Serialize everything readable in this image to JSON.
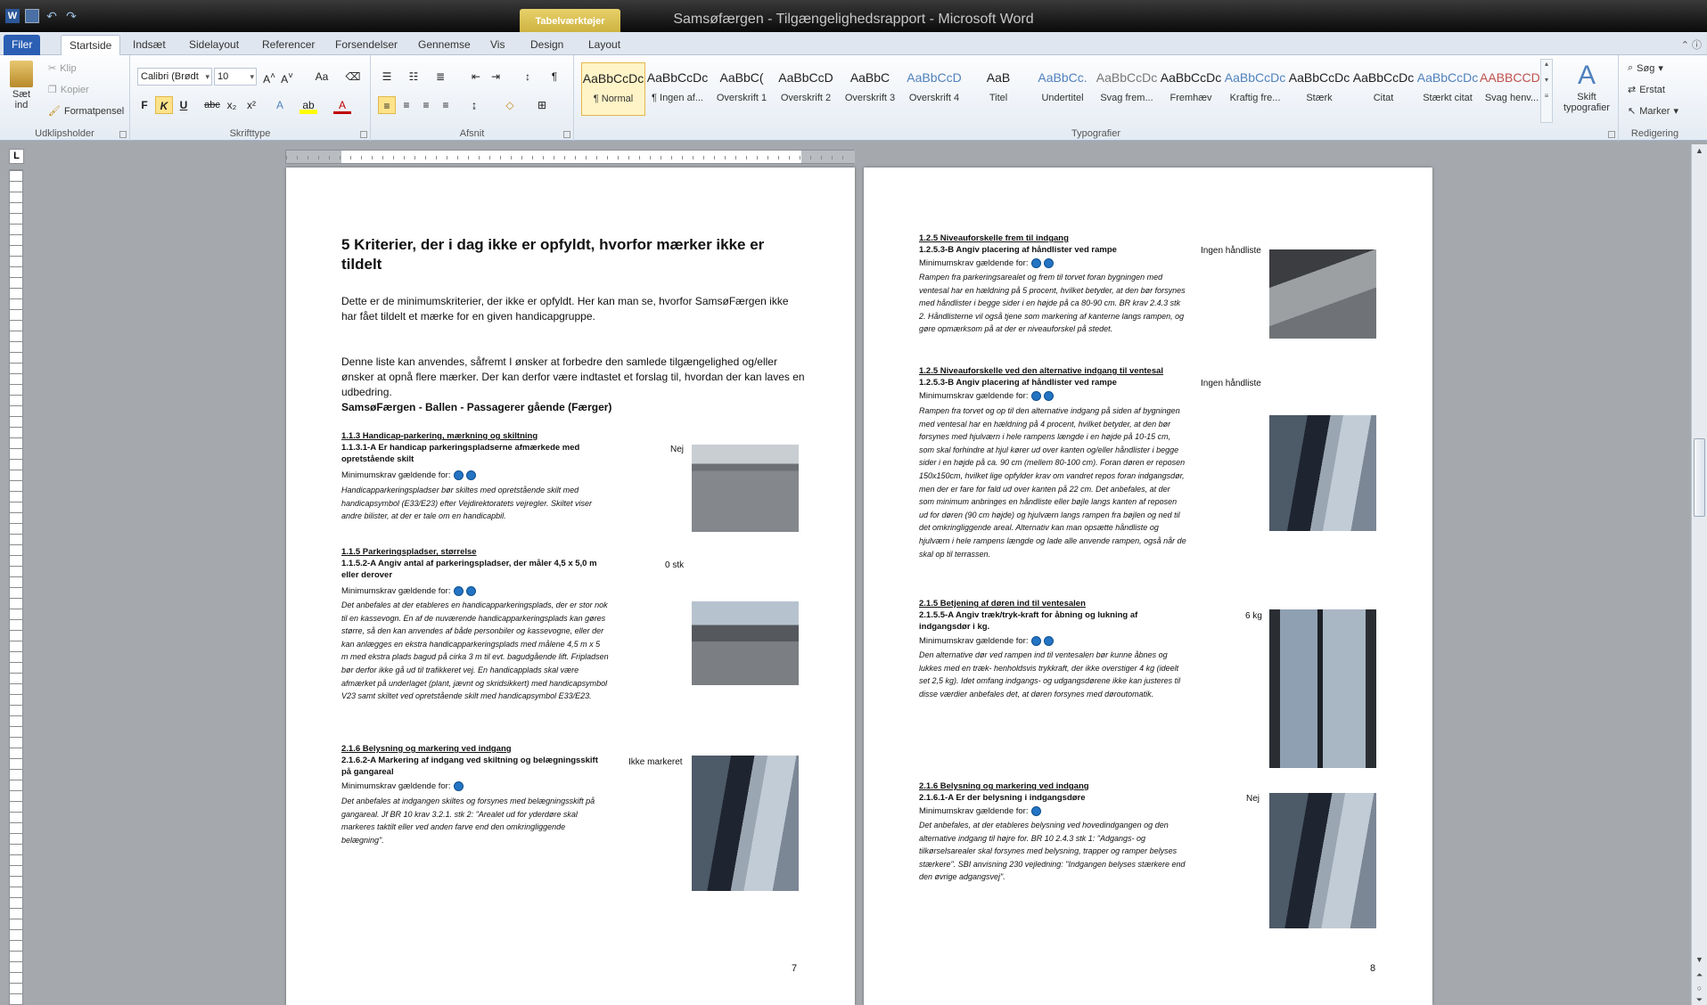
{
  "window": {
    "title": "Samsøfærgen - Tilgængelighedsrapport - Microsoft Word",
    "context_tab": "Tabelværktøjer"
  },
  "tabs": [
    "Filer",
    "Startside",
    "Indsæt",
    "Sidelayout",
    "Referencer",
    "Forsendelser",
    "Gennemse",
    "Vis",
    "Design",
    "Layout"
  ],
  "ribbon": {
    "clipboard": {
      "paste": "Sæt ind",
      "cut": "Klip",
      "copy": "Kopier",
      "format_painter": "Formatpensel",
      "label": "Udklipsholder"
    },
    "font": {
      "name": "Calibri (Brødt",
      "size": "10",
      "label": "Skrifttype"
    },
    "paragraph": {
      "label": "Afsnit"
    },
    "styles": {
      "label": "Typografier",
      "items": [
        {
          "preview": "AaBbCcDc",
          "name": "¶ Normal",
          "color": "#222"
        },
        {
          "preview": "AaBbCcDc",
          "name": "¶ Ingen af...",
          "color": "#222"
        },
        {
          "preview": "AaBbC(",
          "name": "Overskrift 1",
          "color": "#222"
        },
        {
          "preview": "AaBbCcD",
          "name": "Overskrift 2",
          "color": "#222"
        },
        {
          "preview": "AaBbC",
          "name": "Overskrift 3",
          "color": "#222"
        },
        {
          "preview": "AaBbCcD",
          "name": "Overskrift 4",
          "color": "#4f81bd"
        },
        {
          "preview": "AaB",
          "name": "Titel",
          "color": "#222"
        },
        {
          "preview": "AaBbCc.",
          "name": "Undertitel",
          "color": "#4f81bd"
        },
        {
          "preview": "AaBbCcDc",
          "name": "Svag frem...",
          "color": "#777"
        },
        {
          "preview": "AaBbCcDc",
          "name": "Fremhæv",
          "color": "#222"
        },
        {
          "preview": "AaBbCcDc",
          "name": "Kraftig fre...",
          "color": "#4f81bd"
        },
        {
          "preview": "AaBbCcDc",
          "name": "Stærk",
          "color": "#222"
        },
        {
          "preview": "AaBbCcDc",
          "name": "Citat",
          "color": "#222"
        },
        {
          "preview": "AaBbCcDc",
          "name": "Stærkt citat",
          "color": "#4f81bd"
        },
        {
          "preview": "AABBCCDC",
          "name": "Svag henv...",
          "color": "#c0504d"
        }
      ],
      "change_styles": "Skift typografier"
    },
    "editing": {
      "find": "Søg",
      "replace": "Erstat",
      "select": "Marker",
      "label": "Redigering"
    }
  },
  "page7": {
    "heading": "5 Kriterier, der i dag ikke er opfyldt, hvorfor mærker ikke er tildelt",
    "intro1": "Dette er de minimumskriterier, der ikke er opfyldt. Her kan man se, hvorfor SamsøFærgen ikke har fået tildelt et mærke for en given handicapgruppe.",
    "intro2": "Denne liste kan anvendes, såfremt I ønsker at forbedre den samlede tilgængelighed og/eller ønsker at opnå flere mærker. Der kan derfor være indtastet et forslag til, hvordan der kan laves en udbedring.",
    "subheading": "SamsøFærgen - Ballen - Passagerer gående (Færger)",
    "req_label": "Minimumskrav gældende for:",
    "items": [
      {
        "section": "1.1.3 Handicap-parkering, mærkning og skiltning",
        "title": "1.1.3.1-A Er handicap parkeringspladserne afmærkede med opretstående skilt",
        "answer": "Nej",
        "text": "Handicapparkeringspladser bør skiltes med opretstående skilt med handicapsymbol (E33/E23) efter Vejdirektoratets vejregler. Skiltet viser andre bilister, at der er tale om en handicapbil."
      },
      {
        "section": "1.1.5 Parkeringspladser, størrelse",
        "title": "1.1.5.2-A Angiv antal af parkeringspladser, der måler 4,5 x 5,0 m eller derover",
        "answer": "0 stk",
        "text": "Det anbefales at der etableres en handicapparkeringsplads, der er stor nok til en kassevogn. En af de nuværende handicapparkeringsplads kan gøres større, så den kan anvendes af både personbiler og kassevogne, eller der kan anlægges en ekstra handicapparkeringsplads med målene 4,5 m x 5 m med ekstra plads bagud på cirka 3 m til evt. bagudgående lift. Fripladsen bør derfor ikke gå ud til trafikkeret vej. En handicapplads skal være afmærket på underlaget (plant, jævnt og skridsikkert) med handicapsymbol V23 samt skiltet ved opretstående skilt med handicapsymbol E33/E23."
      },
      {
        "section": "2.1.6 Belysning og markering ved indgang",
        "title": "2.1.6.2-A Markering af indgang ved skiltning og belægningsskift på gangareal",
        "answer": "Ikke markeret",
        "text": "Det anbefales at indgangen skiltes og forsynes med belægningsskift på gangareal. Jf BR 10 krav 3.2.1. stk 2: \"Arealet ud for yderdøre skal markeres taktilt eller ved anden farve end den omkringliggende belægning\"."
      }
    ],
    "page_number": "7"
  },
  "page8": {
    "req_label": "Minimumskrav gældende for:",
    "items": [
      {
        "section": "1.2.5 Niveauforskelle frem til indgang",
        "title": "1.2.5.3-B Angiv placering af håndlister ved rampe",
        "answer": "Ingen håndliste",
        "text": "Rampen fra parkeringsarealet og frem til torvet foran bygningen med ventesal har en hældning på 5 procent, hvilket betyder, at den bør forsynes med håndlister i begge sider i en højde på ca 80-90 cm. BR krav 2.4.3 stk 2. Håndlisterne vil også tjene som markering af kanterne langs rampen, og gøre opmærksom på at der er niveauforskel på stedet."
      },
      {
        "section": "1.2.5 Niveauforskelle ved den alternative indgang til ventesal",
        "title": "1.2.5.3-B Angiv placering af håndlister ved rampe",
        "answer": "Ingen håndliste",
        "text": "Rampen fra torvet og op til den alternative indgang på siden af bygningen med ventesal har en hældning på 4 procent, hvilket betyder, at den bør forsynes med hjulværn i hele rampens længde i en højde på 10-15 cm, som skal forhindre at hjul kører ud over kanten og/eller håndlister i begge sider i en højde på ca. 90 cm (mellem 80-100 cm). Foran døren er reposen 150x150cm, hvilket lige opfylder krav om vandret repos foran indgangsdør, men der er fare for fald ud over kanten på 22 cm. Det anbefales, at der som minimum anbringes en håndliste eller bøjle langs kanten af reposen ud for døren (90 cm højde) og hjulværn langs rampen fra bøjlen og ned til det omkringliggende areal. Alternativ kan man opsætte håndliste og hjulværn i hele rampens længde og lade alle anvende rampen, også når de skal op til terrassen."
      },
      {
        "section": "2.1.5 Betjening af døren ind til ventesalen",
        "title": "2.1.5.5-A Angiv træk/tryk-kraft for åbning og lukning af indgangsdør i kg.",
        "answer": "6 kg",
        "text": "Den alternative dør ved rampen ind til ventesalen bør kunne åbnes og lukkes med en træk- henholdsvis trykkraft, der ikke overstiger 4 kg (ideelt set 2,5 kg). Idet omfang indgangs- og udgangsdørene ikke kan justeres til disse værdier anbefales det, at døren forsynes med døroutomatik."
      },
      {
        "section": "2.1.6 Belysning og markering ved indgang",
        "title": "2.1.6.1-A Er der belysning i indgangsdøre",
        "answer": "Nej",
        "text": "Det anbefales, at der etableres belysning ved hovedindgangen og den alternative indgang til højre for. BR 10 2.4.3 stk 1: \"Adgangs- og tilkørselsarealer skal forsynes med belysning, trapper og ramper belyses stærkere\". SBI anvisning 230 vejledning: \"Indgangen belyses stærkere end den øvrige adgangsvej\"."
      }
    ],
    "page_number": "8"
  }
}
